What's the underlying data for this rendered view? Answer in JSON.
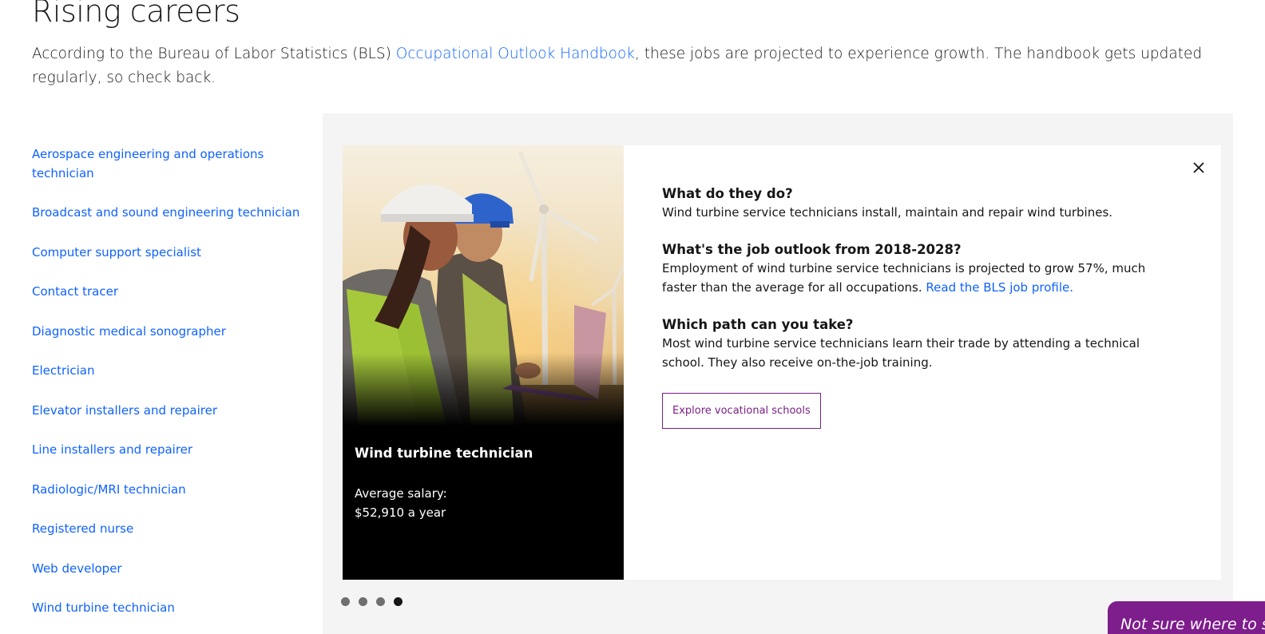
{
  "header": {
    "title": "Rising careers",
    "intro_before": "According to the Bureau of Labor Statistics (BLS) ",
    "intro_link": "Occupational Outlook Handbook",
    "intro_after": ", these jobs are projected to experience growth. The handbook gets updated regularly, so check back."
  },
  "jobs": [
    "Aerospace engineering and operations technician",
    "Broadcast and sound engineering technician",
    "Computer support specialist",
    "Contact tracer",
    "Diagnostic medical sonographer",
    "Electrician",
    "Elevator installers and repairer",
    "Line installers and repairer",
    "Radiologic/MRI technician",
    "Registered nurse",
    "Web developer",
    "Wind turbine technician"
  ],
  "card": {
    "job_title": "Wind turbine technician",
    "salary_label": "Average salary:",
    "salary_value": "$52,910 a year",
    "q1": "What do they do?",
    "a1": "Wind turbine service technicians install, maintain and repair wind turbines.",
    "q2": "What's the job outlook from 2018-2028?",
    "a2": "Employment of wind turbine service technicians is projected to grow 57%, much faster than the average for all occupations. ",
    "a2_link": "Read the BLS job profile.",
    "q3": "Which path can you take?",
    "a3": "Most wind turbine service technicians learn their trade by attending a technical school. They also receive on-the-job training.",
    "button": "Explore vocational schools"
  },
  "carousel": {
    "count": 4,
    "active": 4
  },
  "chat_tab": "Not sure where to start?",
  "colors": {
    "link": "#0f62fe",
    "accent_purple": "#7e1d8c",
    "panel_bg": "#f4f4f4"
  }
}
